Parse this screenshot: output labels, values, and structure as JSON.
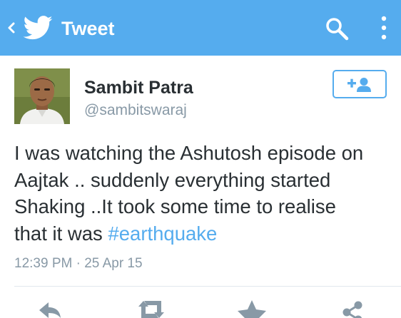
{
  "header": {
    "title": "Tweet",
    "icons": [
      "back-chevron-icon",
      "twitter-bird-icon",
      "search-icon",
      "more-vertical-icon"
    ]
  },
  "tweet": {
    "author_name": "Sambit Patra",
    "author_handle": "@sambitswaraj",
    "text_line1": "I was watching the Ashutosh episode on",
    "text_line2": "Aajtak .. suddenly everything started",
    "text_line3": "Shaking ..It took some time to realise",
    "text_line4_prefix": "that it was ",
    "hashtag": "#earthquake",
    "timestamp": "12:39 PM · 25 Apr 15"
  },
  "actions": [
    "reply-icon",
    "retweet-icon",
    "favorite-icon",
    "share-icon"
  ],
  "colors": {
    "brand": "#55acee",
    "text": "#292f33",
    "muted": "#8899a6",
    "divider": "#e1e8ed"
  }
}
